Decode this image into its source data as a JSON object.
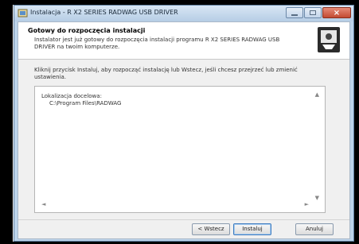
{
  "window": {
    "title": "Instalacja - R X2 SERIES RADWAG USB DRIVER",
    "close_symbol": "×"
  },
  "header": {
    "title": "Gotowy do rozpoczęcia instalacji",
    "subtitle": "Instalator jest już gotowy do rozpoczęcia instalacji programu R X2 SERIES RADWAG USB DRIVER na twoim komputerze."
  },
  "body": {
    "instruction": "Kliknij przycisk Instaluj, aby rozpocząć instalację lub Wstecz, jeśli chcesz przejrzeć lub zmienić ustawienia.",
    "memo_label": "Lokalizacja docelowa:",
    "memo_path": "C:\\Program Files\\RADWAG"
  },
  "scroll": {
    "up": "▲",
    "down": "▼",
    "left": "◄",
    "right": "►"
  },
  "buttons": {
    "back": "< Wstecz",
    "install": "Instaluj",
    "cancel": "Anuluj"
  },
  "colors": {
    "title_bar": "#bcd3ea",
    "close_button": "#c24a32"
  }
}
